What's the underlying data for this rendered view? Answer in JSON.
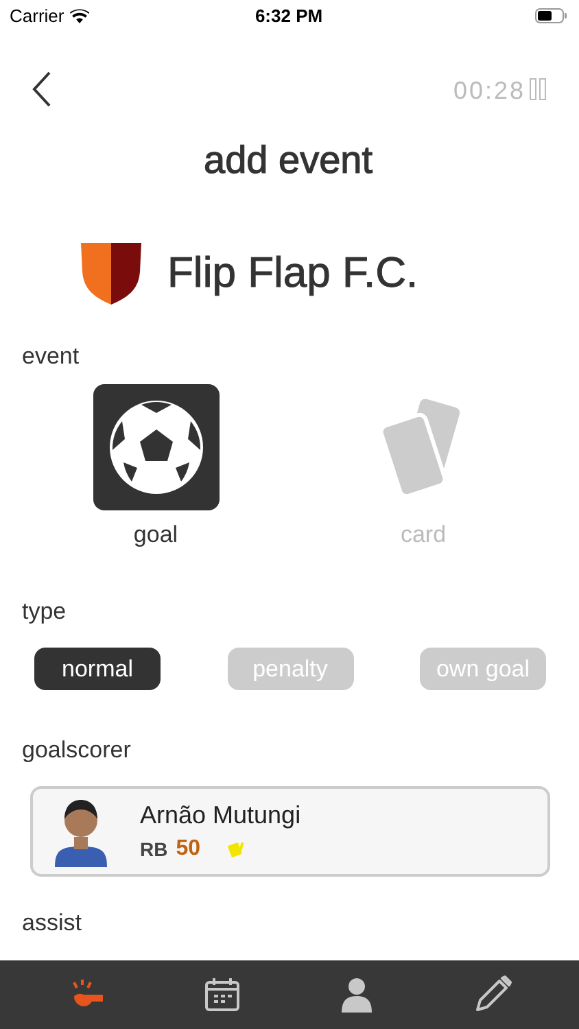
{
  "status_bar": {
    "carrier": "Carrier",
    "time": "6:32 PM"
  },
  "header": {
    "timer": "00:28",
    "title": "add event"
  },
  "team": {
    "name": "Flip Flap F.C."
  },
  "event": {
    "label": "event",
    "options": [
      {
        "kind": "goal",
        "label": "goal",
        "selected": true
      },
      {
        "kind": "card",
        "label": "card",
        "selected": false
      }
    ]
  },
  "type": {
    "label": "type",
    "options": [
      {
        "label": "normal",
        "selected": true
      },
      {
        "label": "penalty",
        "selected": false
      },
      {
        "label": "own goal",
        "selected": false
      }
    ]
  },
  "goalscorer": {
    "label": "goalscorer",
    "player": {
      "name": "Arnão Mutungi",
      "position": "RB",
      "rating": "50",
      "booked": true
    }
  },
  "assist": {
    "label": "assist"
  },
  "tab_bar": {
    "items": [
      {
        "kind": "whistle",
        "selected": true
      },
      {
        "kind": "calendar",
        "selected": false
      },
      {
        "kind": "profile",
        "selected": false
      },
      {
        "kind": "edit",
        "selected": false
      }
    ]
  }
}
